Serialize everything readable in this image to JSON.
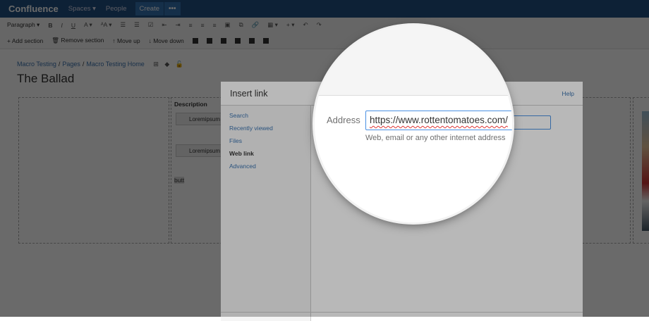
{
  "topbar": {
    "logo": "Confluence",
    "spaces": "Spaces ▾",
    "people": "People",
    "create": "Create",
    "more": "•••"
  },
  "toolbar": {
    "paragraph": "Paragraph ▾",
    "bold": "B",
    "italic": "I",
    "underline": "U",
    "color": "A ▾",
    "style": "ᴬA ▾",
    "undo": "↶",
    "redo": "↷",
    "insert": "+ ▾",
    "table": "▦ ▾",
    "add_section": "+ Add section",
    "remove_section": "🗑 Remove section",
    "move_up": "↑ Move up",
    "move_down": "↓ Move down"
  },
  "breadcrumb": [
    "Macro Testing",
    "Pages",
    "Macro Testing Home"
  ],
  "page_title": "The Ballad",
  "content": {
    "description": "Description",
    "macro1": "Loremipsum",
    "macro2": "Loremipsum",
    "butt": "butt"
  },
  "dialog": {
    "title": "Insert link",
    "help": "Help",
    "nav": [
      "Search",
      "Recently viewed",
      "Files",
      "Web link",
      "Advanced"
    ],
    "active": "Web link",
    "address_label": "Address",
    "address_value": "https://www.rottentomatoes.com/",
    "address_hint": "Web, email or any other internet address"
  },
  "colors": {
    "topbar": "#205081",
    "link": "#3b73af",
    "focus": "#4a90e2"
  }
}
